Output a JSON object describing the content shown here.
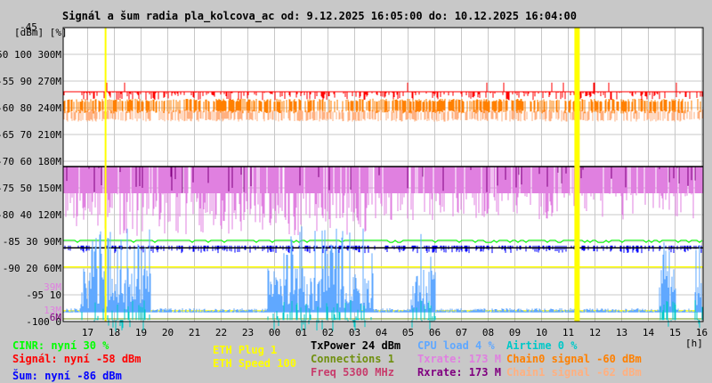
{
  "title": "Signál a šum radia pla_kolcova_ac od: 9.12.2025 16:05:00 do: 10.12.2025 16:04:00",
  "chart_data": {
    "type": "line",
    "title": "Signál a šum radia pla_kolcova_ac od: 9.12.2025 16:05:00 do: 10.12.2025 16:04:00",
    "xlabel": "[h]",
    "ylabel": "[dBm] [%]",
    "y_top_label": "-45",
    "ylim": [
      -100,
      -45
    ],
    "x_ticks": [
      "17",
      "18",
      "19",
      "20",
      "21",
      "22",
      "23",
      "00",
      "01",
      "02",
      "03",
      "04",
      "05",
      "06",
      "07",
      "08",
      "09",
      "10",
      "11",
      "12",
      "13",
      "14",
      "15",
      "16"
    ],
    "y_ticks": [
      {
        "dbm": "-50",
        "pct": "100",
        "rate": "300M"
      },
      {
        "dbm": "-55",
        "pct": "90",
        "rate": "270M"
      },
      {
        "dbm": "-60",
        "pct": "80",
        "rate": "240M"
      },
      {
        "dbm": "-65",
        "pct": "70",
        "rate": "210M"
      },
      {
        "dbm": "-70",
        "pct": "60",
        "rate": "180M"
      },
      {
        "dbm": "-75",
        "pct": "50",
        "rate": "150M"
      },
      {
        "dbm": "-80",
        "pct": "40",
        "rate": "120M"
      },
      {
        "dbm": "-85",
        "pct": "30",
        "rate": "90M"
      },
      {
        "dbm": "-90",
        "pct": "20",
        "rate": "60M"
      },
      {
        "dbm": "-95",
        "pct": "10",
        "rate": ""
      },
      {
        "dbm": "-100",
        "pct": "0",
        "rate": ""
      }
    ],
    "extra_rate_labels": [
      {
        "text": "39M",
        "dbm": -93.5,
        "color": "#e080e0"
      },
      {
        "text": "13M",
        "dbm": -97.8,
        "color": "#e080e0"
      },
      {
        "text": "6M",
        "dbm": -99.2,
        "color": "#800080"
      }
    ],
    "grid": true,
    "series": [
      {
        "name": "Signál",
        "color": "#ff0000",
        "level_dbm": -57.8,
        "current": -58
      },
      {
        "name": "Chain0 signal",
        "color": "#ff8000",
        "level_dbm": -59.5,
        "current": -60
      },
      {
        "name": "Chain1 signal",
        "color": "#ffb080",
        "level_dbm": -61.2,
        "current": -62
      },
      {
        "name": "Txrate",
        "color": "#e080e0",
        "level_dbm": -75.5,
        "current_mbit": 173
      },
      {
        "name": "Rxrate",
        "color": "#800080",
        "level_dbm": -71,
        "current_mbit": 173
      },
      {
        "name": "CINR",
        "color": "#00ff00",
        "level_dbm": -84.8,
        "current_pct": 30
      },
      {
        "name": "Šum",
        "color": "#0000ff",
        "level_dbm": -86,
        "current": -86
      },
      {
        "name": "CPU load",
        "color": "#60a8ff",
        "level_dbm": -98,
        "current_pct": 4
      },
      {
        "name": "Airtime",
        "color": "#00c8c8",
        "level_dbm": -99.5,
        "current_pct": 0
      }
    ],
    "reference_lines_dbm": [
      -71,
      -86.2
    ],
    "yellow_lines_dbm": [
      -89.8,
      -98
    ],
    "eth_events_hours": [
      17.67,
      11.33
    ]
  },
  "legend": {
    "cinr": "CINR: nyní 30 %",
    "signal": "Signál: nyní -58 dBm",
    "noise": "Šum: nyní -86 dBm",
    "eth_plug": "ETH Plug 1",
    "eth_speed": "ETH Speed 100",
    "txpower": "TxPower 24 dBm",
    "connections": "Connections 1",
    "freq": "Freq 5300 MHz",
    "cpu": "CPU load 4 %",
    "txrate": "Txrate: 173 M",
    "rxrate": "Rxrate: 173 M",
    "airtime": "Airtime 0 %",
    "chain0": "Chain0 signal -60 dBm",
    "chain1": "Chain1 signal -62 dBm"
  }
}
